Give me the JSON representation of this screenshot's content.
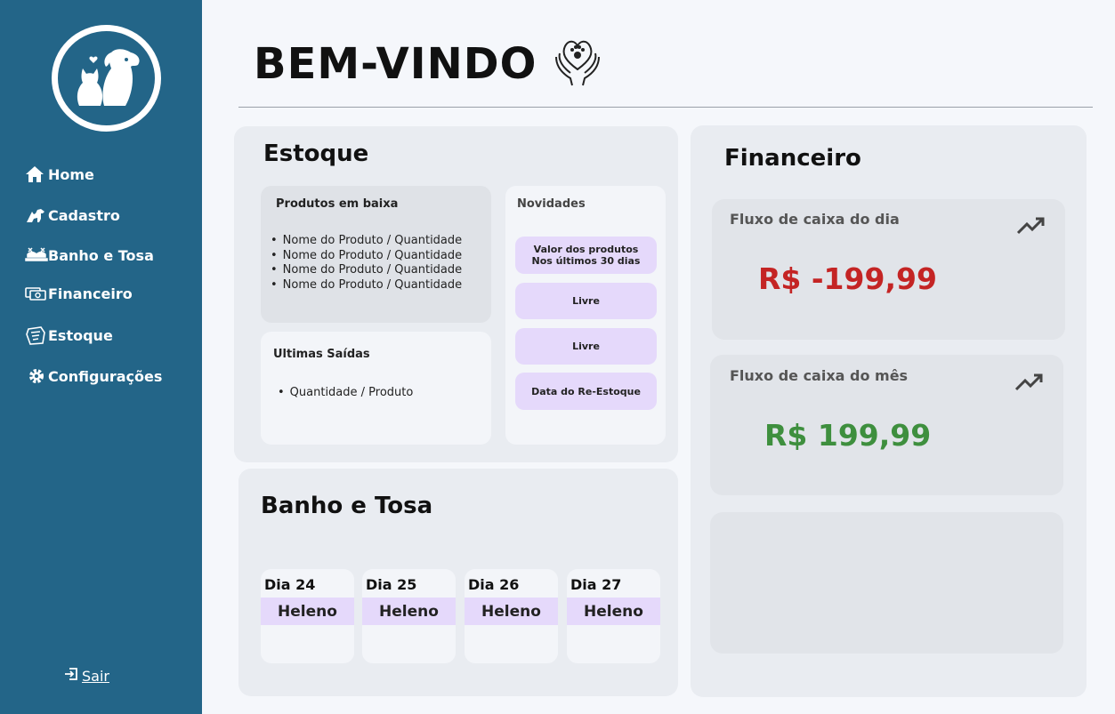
{
  "sidebar": {
    "logo_icon": "dog-and-cat-logo",
    "items": [
      {
        "label": "Home",
        "icon": "home-icon"
      },
      {
        "label": "Cadastro",
        "icon": "pets-icon"
      },
      {
        "label": "Banho e Tosa",
        "icon": "grooming-icon"
      },
      {
        "label": "Financeiro",
        "icon": "money-icon"
      },
      {
        "label": "Estoque",
        "icon": "box-icon"
      },
      {
        "label": "Configurações",
        "icon": "gear-icon"
      }
    ],
    "logout_label": "Sair"
  },
  "header": {
    "title": "BEM-VINDO",
    "icon": "heart-paw-hands-icon"
  },
  "estoque": {
    "title": "Estoque",
    "low_products": {
      "title": "Produtos em baixa",
      "items": [
        "Nome do Produto / Quantidade",
        "Nome do Produto / Quantidade",
        "Nome do Produto / Quantidade",
        "Nome do Produto / Quantidade"
      ]
    },
    "last_outputs": {
      "title": "Ultimas Saídas",
      "items": [
        "Quantidade / Produto"
      ]
    },
    "news": {
      "title": "Novidades",
      "pills": [
        "Valor dos produtos\nNos últimos 30 dias",
        "Livre",
        "Livre",
        "Data do Re-Estoque"
      ]
    }
  },
  "banho_tosa": {
    "title": "Banho e Tosa",
    "days": [
      {
        "day": "Dia 24",
        "name": "Heleno"
      },
      {
        "day": "Dia 25",
        "name": "Heleno"
      },
      {
        "day": "Dia 26",
        "name": "Heleno"
      },
      {
        "day": "Dia 27",
        "name": "Heleno"
      }
    ]
  },
  "financeiro": {
    "title": "Financeiro",
    "daily": {
      "title": "Fluxo de caixa do dia",
      "value": "R$ -199,99",
      "color": "#c42424",
      "icon": "trending-up-icon"
    },
    "monthly": {
      "title": "Fluxo de caixa do mês",
      "value": "R$ 199,99",
      "color": "#3e8f3e",
      "icon": "trending-up-icon"
    }
  }
}
